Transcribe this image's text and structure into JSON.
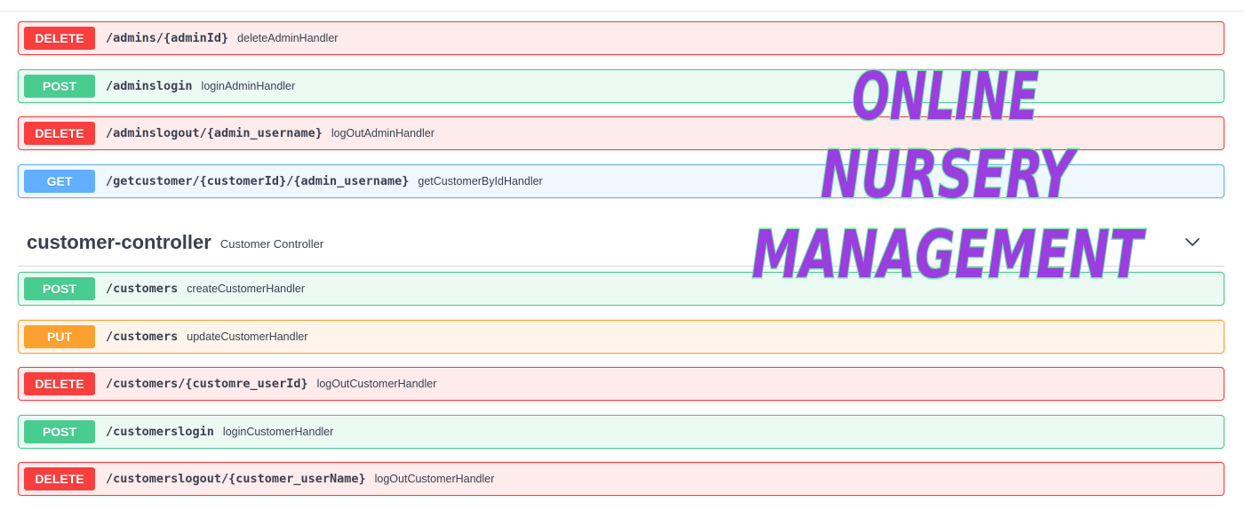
{
  "operations_top": [
    {
      "method": "DELETE",
      "path": "/admins/{adminId}",
      "summary": "deleteAdminHandler"
    },
    {
      "method": "POST",
      "path": "/adminslogin",
      "summary": "loginAdminHandler"
    },
    {
      "method": "DELETE",
      "path": "/adminslogout/{admin_username}",
      "summary": "logOutAdminHandler"
    },
    {
      "method": "GET",
      "path": "/getcustomer/{customerId}/{admin_username}",
      "summary": "getCustomerByIdHandler"
    }
  ],
  "tag": {
    "name": "customer-controller",
    "description": "Customer Controller",
    "toggle_icon": "chevron-down-icon"
  },
  "operations_customer": [
    {
      "method": "POST",
      "path": "/customers",
      "summary": "createCustomerHandler"
    },
    {
      "method": "PUT",
      "path": "/customers",
      "summary": "updateCustomerHandler"
    },
    {
      "method": "DELETE",
      "path": "/customers/{customre_userId}",
      "summary": "logOutCustomerHandler"
    },
    {
      "method": "POST",
      "path": "/customerslogin",
      "summary": "loginCustomerHandler"
    },
    {
      "method": "DELETE",
      "path": "/customerslogout/{customer_userName}",
      "summary": "logOutCustomerHandler"
    }
  ],
  "overlay": {
    "lines": [
      "ONLINE",
      "NURSERY",
      "MANAGEMENT"
    ],
    "fill_color": "#9b3ee0",
    "outline_color": "#6ee7a0"
  },
  "colors": {
    "delete": "#f93e3e",
    "post": "#49cc90",
    "get": "#61affe",
    "put": "#fca130"
  }
}
